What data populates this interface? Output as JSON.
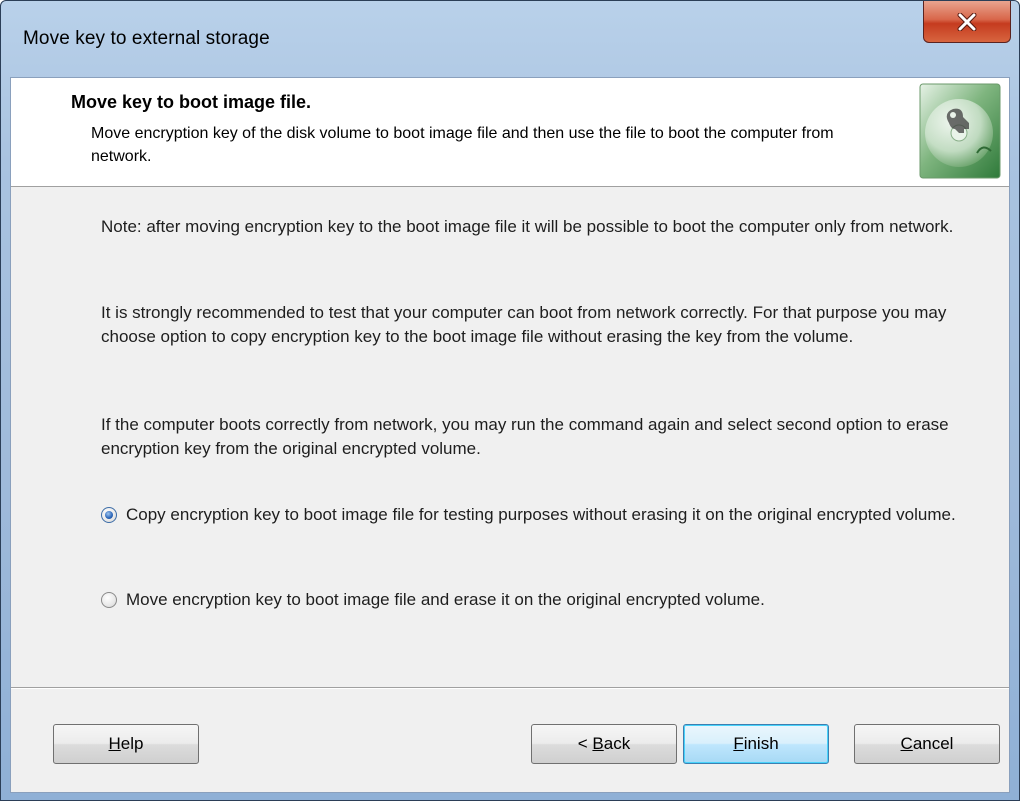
{
  "window": {
    "title": "Move key to external storage",
    "close_icon": "close-icon"
  },
  "header": {
    "title": "Move key to boot image file.",
    "description": "Move encryption key of the disk volume to boot image file and then use the file to boot the computer from network.",
    "icon": "key-disk-icon"
  },
  "body": {
    "note": "Note: after moving encryption key to the boot image file it will be possible to boot the computer only from network.",
    "recommendation": "It is strongly recommended to test that your computer can boot from network correctly. For that purpose you may choose option to copy encryption key to the boot image file without erasing the key from the volume.",
    "followup": "If the computer boots correctly from network, you may run the command again and select second option to erase encryption key from the original encrypted volume."
  },
  "options": [
    {
      "label": "Copy encryption key to boot image file for testing purposes without erasing it on the original encrypted volume.",
      "selected": true
    },
    {
      "label": "Move encryption key to boot image file and erase it on the original encrypted volume.",
      "selected": false
    }
  ],
  "buttons": {
    "help": {
      "prefix": "",
      "mnemonic": "H",
      "rest": "elp"
    },
    "back": {
      "prefix": "< ",
      "mnemonic": "B",
      "rest": "ack"
    },
    "finish": {
      "prefix": "",
      "mnemonic": "F",
      "rest": "inish"
    },
    "cancel": {
      "prefix": "",
      "mnemonic": "C",
      "rest": "ancel"
    }
  }
}
